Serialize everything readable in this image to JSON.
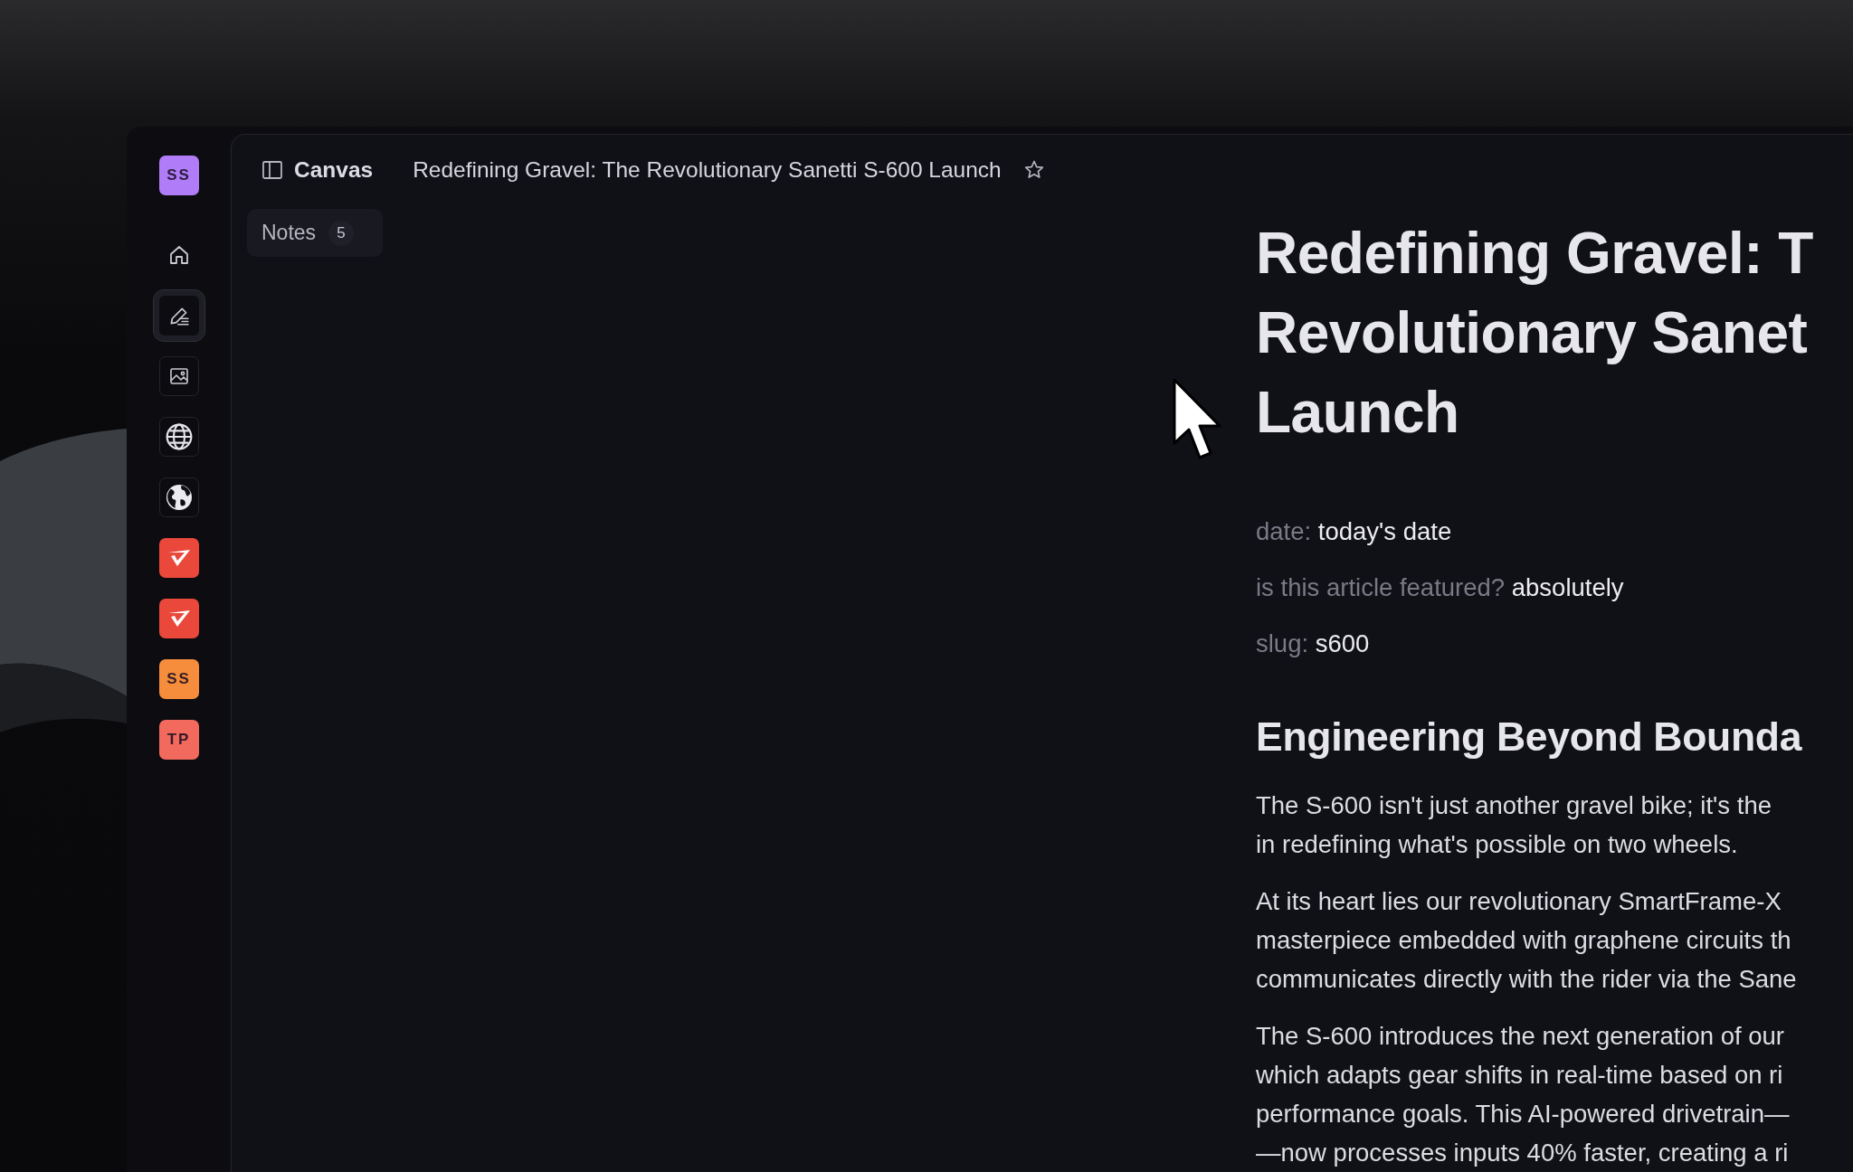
{
  "sidebar": {
    "items": [
      {
        "kind": "avatar",
        "label": "SS",
        "color": "#b07cf7",
        "selected": false
      },
      {
        "kind": "home",
        "selected": false
      },
      {
        "kind": "compose",
        "selected": true
      },
      {
        "kind": "image",
        "selected": false
      },
      {
        "kind": "globe",
        "selected": false
      },
      {
        "kind": "earth",
        "selected": false
      },
      {
        "kind": "app",
        "color": "#e9483b",
        "selected": false
      },
      {
        "kind": "app",
        "color": "#e9483b",
        "selected": false
      },
      {
        "kind": "avatar",
        "label": "SS",
        "color": "#f68d3c",
        "selected": false
      },
      {
        "kind": "avatar",
        "label": "TP",
        "color": "#f26a5e",
        "selected": false
      }
    ]
  },
  "top_bar": {
    "section": "Canvas",
    "title": "Redefining Gravel: The Revolutionary Sanetti S-600 Launch",
    "starred": false
  },
  "notes_tab": {
    "label": "Notes",
    "count": "5"
  },
  "article": {
    "title_lines": [
      "Redefining Gravel: T",
      "Revolutionary Sanet",
      "Launch"
    ],
    "meta": [
      {
        "label": "date:",
        "value": "today's date"
      },
      {
        "label": "is this article featured?",
        "value": "absolutely"
      },
      {
        "label": "slug:",
        "value": "s600"
      }
    ],
    "heading": "Engineering Beyond Bounda",
    "paragraphs": [
      {
        "lines": [
          "The S-600 isn't just another gravel bike; it's the",
          "in redefining what's possible on two wheels."
        ]
      },
      {
        "lines": [
          "At its heart lies our revolutionary SmartFrame-X",
          "masterpiece embedded with graphene circuits th",
          "communicates directly with the rider via the Sane"
        ]
      },
      {
        "lines": [
          "The S-600 introduces the next generation of our",
          "which adapts gear shifts in real-time based on ri",
          "performance goals. This AI-powered drivetrain—",
          "—now processes inputs 40% faster, creating a ri"
        ]
      }
    ]
  }
}
